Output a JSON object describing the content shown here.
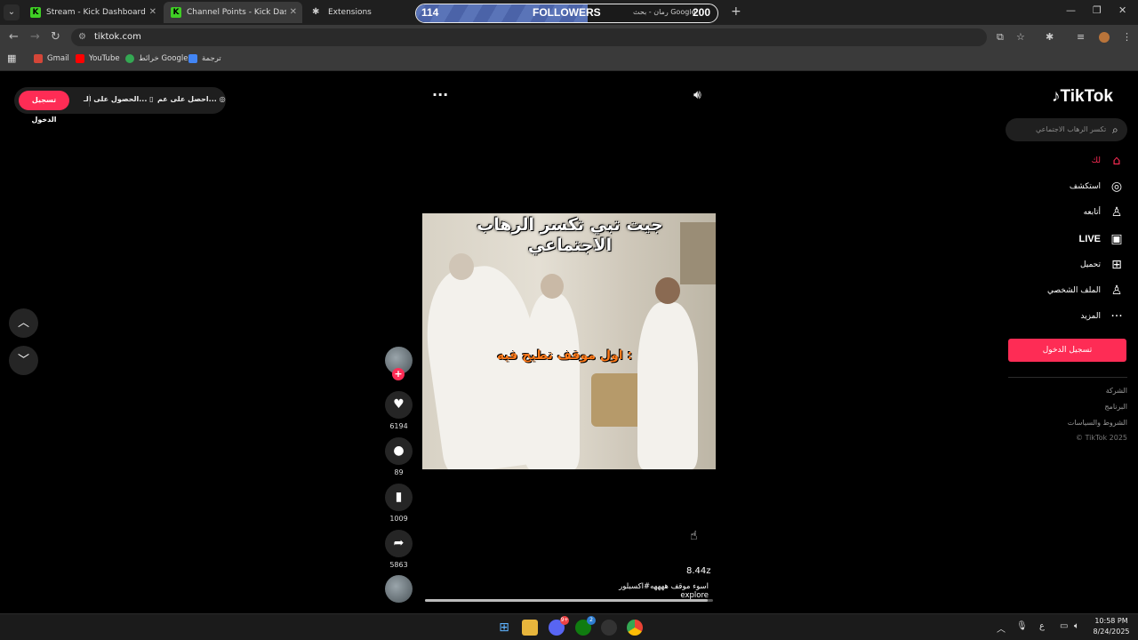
{
  "browser": {
    "tabs": [
      {
        "title": "Stream - Kick Dashboard",
        "active": false
      },
      {
        "title": "Channel Points - Kick Dashboard",
        "active": true
      },
      {
        "title": "Extensions",
        "active": false
      }
    ],
    "url": "tiktok.com",
    "bookmarks": [
      "Gmail",
      "YouTube",
      "خرائط Google",
      "ترجمة"
    ]
  },
  "followers_overlay": {
    "current": "114",
    "label": "FOLLOWERS",
    "goal": "200",
    "progress_fraction": 0.57,
    "hidden_tab_text": "رمان - بحث Google"
  },
  "tiktok": {
    "logo": "TikTok",
    "search_placeholder": "تكسر الرهاب الاجتماعي",
    "nav": [
      {
        "label": "لك",
        "icon": "home-icon",
        "active": true
      },
      {
        "label": "استكشف",
        "icon": "compass-icon",
        "active": false
      },
      {
        "label": "أتابعه",
        "icon": "user-plus-icon",
        "active": false
      },
      {
        "label": "LIVE",
        "icon": "live-tv-icon",
        "active": false
      },
      {
        "label": "تحميل",
        "icon": "upload-icon",
        "active": false
      },
      {
        "label": "الملف الشخصي",
        "icon": "profile-icon",
        "active": false
      },
      {
        "label": "المزيد",
        "icon": "more-icon",
        "active": false
      }
    ],
    "side_login": "تسجيل الدخول",
    "footer": [
      "الشركة",
      "البرنامج",
      "الشروط والسياسات",
      "© TikTok 2025"
    ],
    "top_pill": {
      "login": "تسجيل الدخول",
      "get_app": "الحصول على الـ...",
      "get_coins": "احصل على عم..."
    },
    "video": {
      "caption_top": "جيت تبي تكسر الرهاب الاجتماعي",
      "caption_mid": "اول موقف تطيح فيه :",
      "username": "8.44z",
      "description": "اسوء موقف ههههه#اكسبلور explore",
      "progress_fraction": 0.98
    },
    "actions": [
      {
        "name": "like",
        "icon": "heart-icon",
        "count": "6194"
      },
      {
        "name": "comment",
        "icon": "comment-icon",
        "count": "89"
      },
      {
        "name": "save",
        "icon": "bookmark-icon",
        "count": "1009"
      },
      {
        "name": "share",
        "icon": "share-icon",
        "count": "5863"
      }
    ]
  },
  "taskbar": {
    "time": "10:58 PM",
    "date": "8/24/2025",
    "discord_badge": "9+",
    "xbox_badge": "2",
    "lang": "ع"
  }
}
